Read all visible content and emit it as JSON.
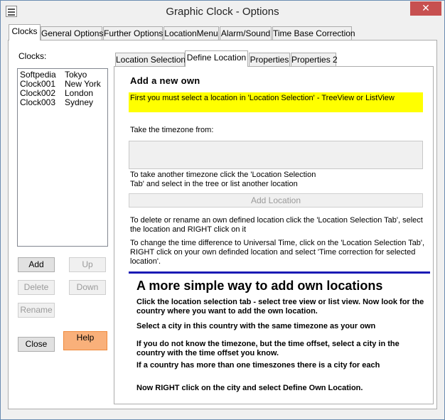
{
  "window": {
    "title": "Graphic Clock - Options",
    "close_symbol": "✕"
  },
  "main_tabs": [
    {
      "label": "Clocks"
    },
    {
      "label": "General Options"
    },
    {
      "label": "Further Options"
    },
    {
      "label": "LocationMenu"
    },
    {
      "label": "Alarm/Sound"
    },
    {
      "label": "Time Base Correction"
    }
  ],
  "clocks_panel": {
    "label": "Clocks:",
    "items": [
      {
        "name": "Softpedia",
        "city": "Tokyo"
      },
      {
        "name": "Clock001",
        "city": "New York"
      },
      {
        "name": "Clock002",
        "city": "London"
      },
      {
        "name": "Clock003",
        "city": "Sydney"
      }
    ],
    "buttons": {
      "add": "Add",
      "up": "Up",
      "delete": "Delete",
      "down": "Down",
      "rename": "Rename",
      "close": "Close",
      "help": "Help"
    }
  },
  "sub_tabs": [
    {
      "label": "Location Selection"
    },
    {
      "label": "Define Location"
    },
    {
      "label": "Properties"
    },
    {
      "label": "Properties 2"
    }
  ],
  "define_location": {
    "heading": "Add a new own",
    "hint": "First you must select a location in 'Location Selection' - TreeView or ListView",
    "timezone_label": "Take the timezone from:",
    "timezone_value": "",
    "other_tz_text": "To take another timezone click the 'Location Selection Tab' and select in the tree or list another location",
    "add_location": "Add Location",
    "delete_rename_text": "To delete or rename an own defined location click the 'Location Selection Tab', select the location and RIGHT click on it",
    "time_diff_text": "To change the time difference to Universal Time, click on the 'Location Selection Tab', RIGHT click on your own definded location and select 'Time correction for selected location'.",
    "simple_heading": "A more simple way to add own locations",
    "simple_1": "Click the location selection tab - select tree view or list view. Now look for the country where you want to add the own location.",
    "simple_2": "Select a city in this country with the same timezone as your own",
    "simple_3": "If you do not know the timezone, but the time offset, select a city in the country with the time offset you know.",
    "simple_4": "If a country has more than one timeszones there is a city for each",
    "simple_5": "Now RIGHT click on the city and select Define Own Location."
  },
  "colors": {
    "hint_bg": "#ffff00",
    "help_bg": "#f9b07a",
    "divider": "#1a1ab4",
    "close_btn": "#c75050"
  }
}
